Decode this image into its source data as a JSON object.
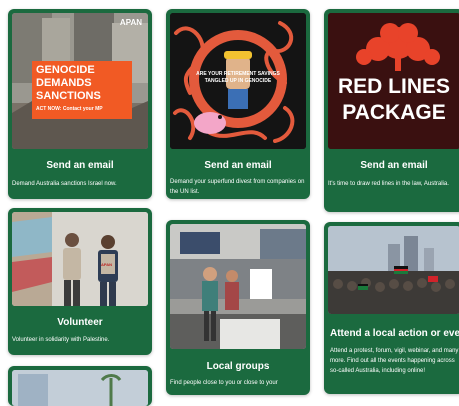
{
  "cards": [
    {
      "title": "Send an email",
      "description": "Demand Australia sanctions Israel now.",
      "poster": {
        "logo": "APAN",
        "headline_lines": [
          "GENOCIDE",
          "DEMANDS",
          "SANCTIONS"
        ],
        "cta": "ACT NOW: Contact your MP"
      }
    },
    {
      "title": "Send an email",
      "description": "Demand your superfund divest from companies on the UN list.",
      "poster": {
        "ring_text": "ARE YOUR RETIREMENT SAVINGS TANGLED UP IN GENOCIDE"
      }
    },
    {
      "title": "Send an email",
      "description": "It's time to draw red lines in the law, Australia.",
      "poster": {
        "headline_lines": [
          "RED LINES",
          "PACKAGE"
        ]
      }
    },
    {
      "title": "Volunteer",
      "description": "Volunteer in solidarity with Palestine.",
      "photo": {
        "vest_label": "APAN"
      }
    },
    {
      "title": "Local groups",
      "description": "Find people close to you or close to your",
      "photo": {}
    },
    {
      "title": "Attend a local action or event",
      "description": "Attend a protest, forum, vigil, webinar, and many more. Find out all the events happening across so-called Australia, including online!",
      "photo": {}
    }
  ],
  "colors": {
    "card_green": "#1b6a3f",
    "poster_red": "#e35a3c",
    "poster_dark_red": "#3a1010",
    "orange": "#f15a24"
  }
}
